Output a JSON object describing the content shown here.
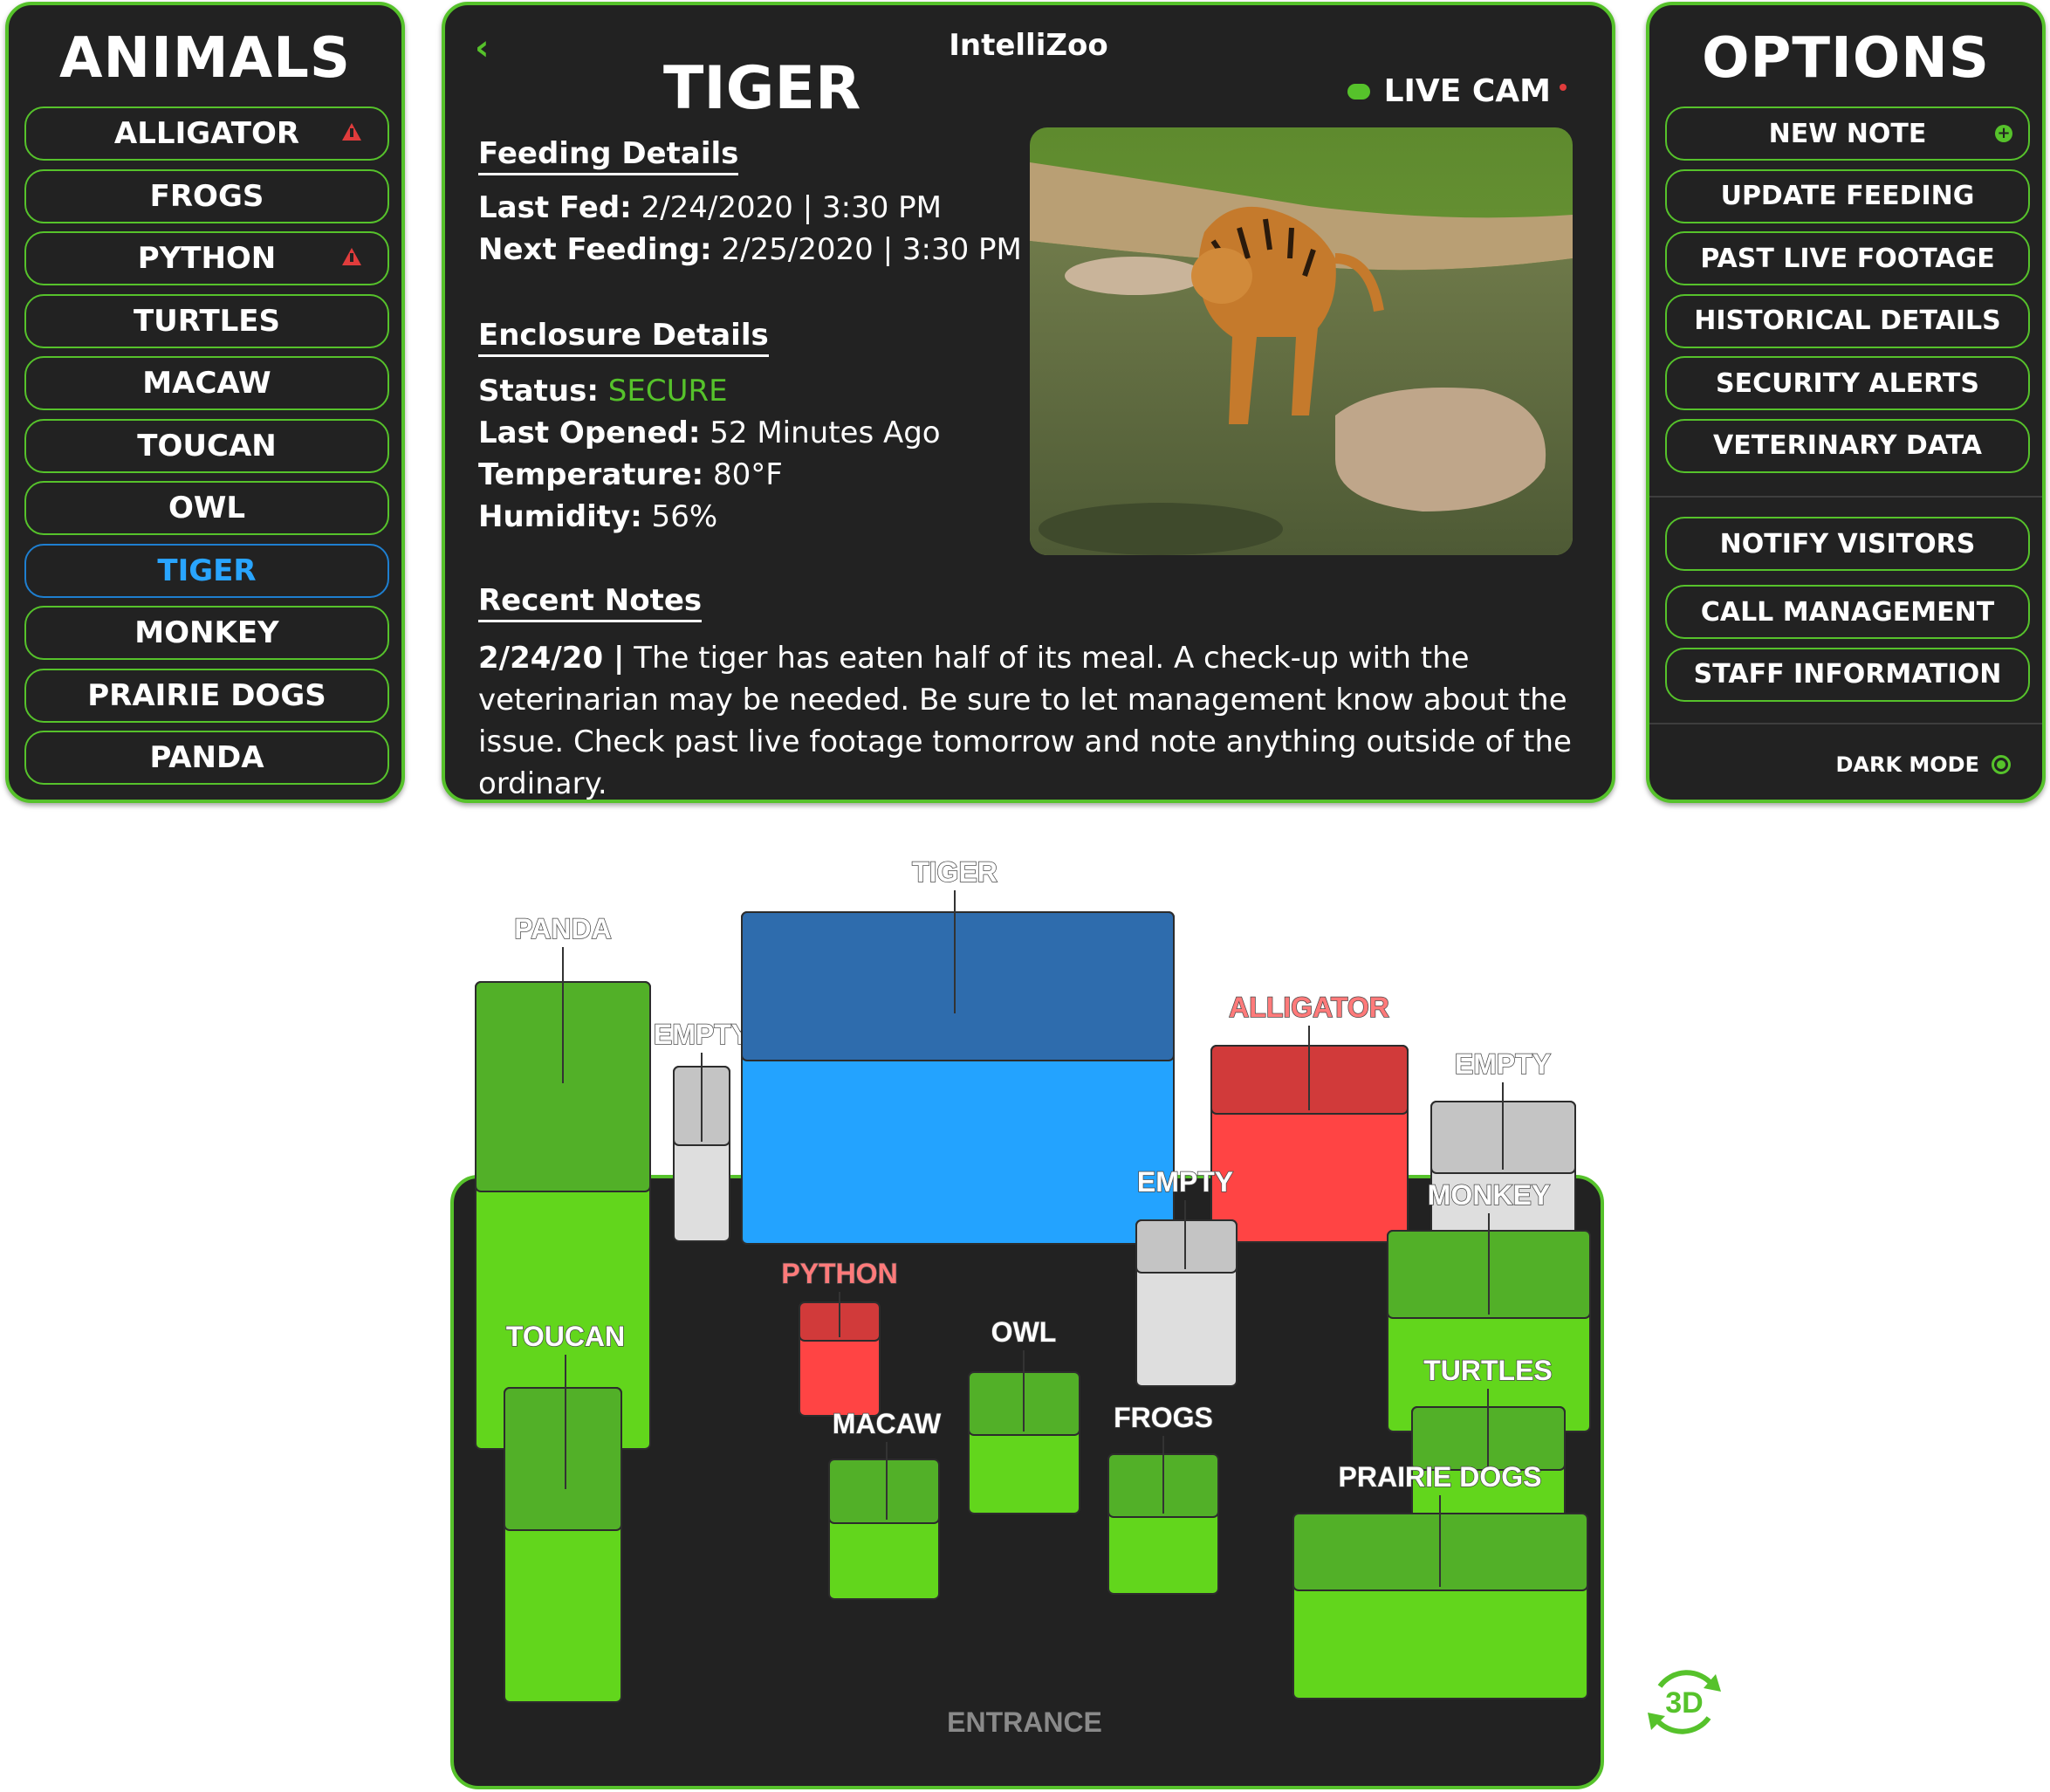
{
  "animals": {
    "title": "ANIMALS",
    "items": [
      {
        "label": "ALLIGATOR",
        "alert": true
      },
      {
        "label": "FROGS",
        "alert": false
      },
      {
        "label": "PYTHON",
        "alert": true
      },
      {
        "label": "TURTLES",
        "alert": false
      },
      {
        "label": "MACAW",
        "alert": false
      },
      {
        "label": "TOUCAN",
        "alert": false
      },
      {
        "label": "OWL",
        "alert": false
      },
      {
        "label": "TIGER",
        "alert": false,
        "selected": true
      },
      {
        "label": "MONKEY",
        "alert": false
      },
      {
        "label": "PRAIRIE DOGS",
        "alert": false
      },
      {
        "label": "PANDA",
        "alert": false
      }
    ]
  },
  "header": {
    "app_title": "IntelliZoo",
    "animal_title": "TIGER",
    "back_icon": "chevron-left-icon",
    "live_cam_label": "LIVE CAM",
    "live_cam_icon": "cloud-icon"
  },
  "feeding": {
    "heading": "Feeding Details",
    "last_fed_label": "Last Fed:",
    "last_fed_value": " 2/24/2020 | 3:30 PM",
    "next_feeding_label": "Next Feeding:",
    "next_feeding_value": " 2/25/2020 | 3:30 PM"
  },
  "enclosure": {
    "heading": "Enclosure Details",
    "status_label": "Status:",
    "status_value": " SECURE",
    "last_opened_label": "Last Opened:",
    "last_opened_value": " 52 Minutes Ago",
    "temperature_label": "Temperature:",
    "temperature_value": " 80°F",
    "humidity_label": "Humidity:",
    "humidity_value": " 56%"
  },
  "notes": {
    "heading": "Recent Notes",
    "date": "2/24/20 |",
    "text": " The tiger has eaten half of its meal. A check-up with the veterinarian may be needed. Be sure to let management know about the issue. Check past live footage tomorrow and note anything outside of the ordinary."
  },
  "options": {
    "title": "OPTIONS",
    "group1": [
      "NEW NOTE",
      "UPDATE FEEDING",
      "PAST LIVE FOOTAGE",
      "HISTORICAL DETAILS",
      "SECURITY ALERTS",
      "VETERINARY DATA"
    ],
    "group2": [
      "NOTIFY VISITORS",
      "CALL MANAGEMENT",
      "STAFF INFORMATION"
    ],
    "dark_mode_label": "DARK MODE"
  },
  "map": {
    "entrance_label": "ENTRANCE",
    "toggle_3d_label": "3D",
    "enclosures": [
      {
        "label": "PANDA",
        "state": "ok"
      },
      {
        "label": "EMPTY",
        "state": "empty"
      },
      {
        "label": "TIGER",
        "state": "selected"
      },
      {
        "label": "ALLIGATOR",
        "state": "alert"
      },
      {
        "label": "EMPTY",
        "state": "empty"
      },
      {
        "label": "EMPTY",
        "state": "empty"
      },
      {
        "label": "MONKEY",
        "state": "ok"
      },
      {
        "label": "PYTHON",
        "state": "alert"
      },
      {
        "label": "OWL",
        "state": "ok"
      },
      {
        "label": "TOUCAN",
        "state": "ok"
      },
      {
        "label": "MACAW",
        "state": "ok"
      },
      {
        "label": "FROGS",
        "state": "ok"
      },
      {
        "label": "TURTLES",
        "state": "ok"
      },
      {
        "label": "PRAIRIE DOGS",
        "state": "ok"
      }
    ]
  },
  "colors": {
    "accent": "#56c22b",
    "alert": "#e03c3c",
    "selected": "#29a5ff",
    "panel": "#222222"
  }
}
